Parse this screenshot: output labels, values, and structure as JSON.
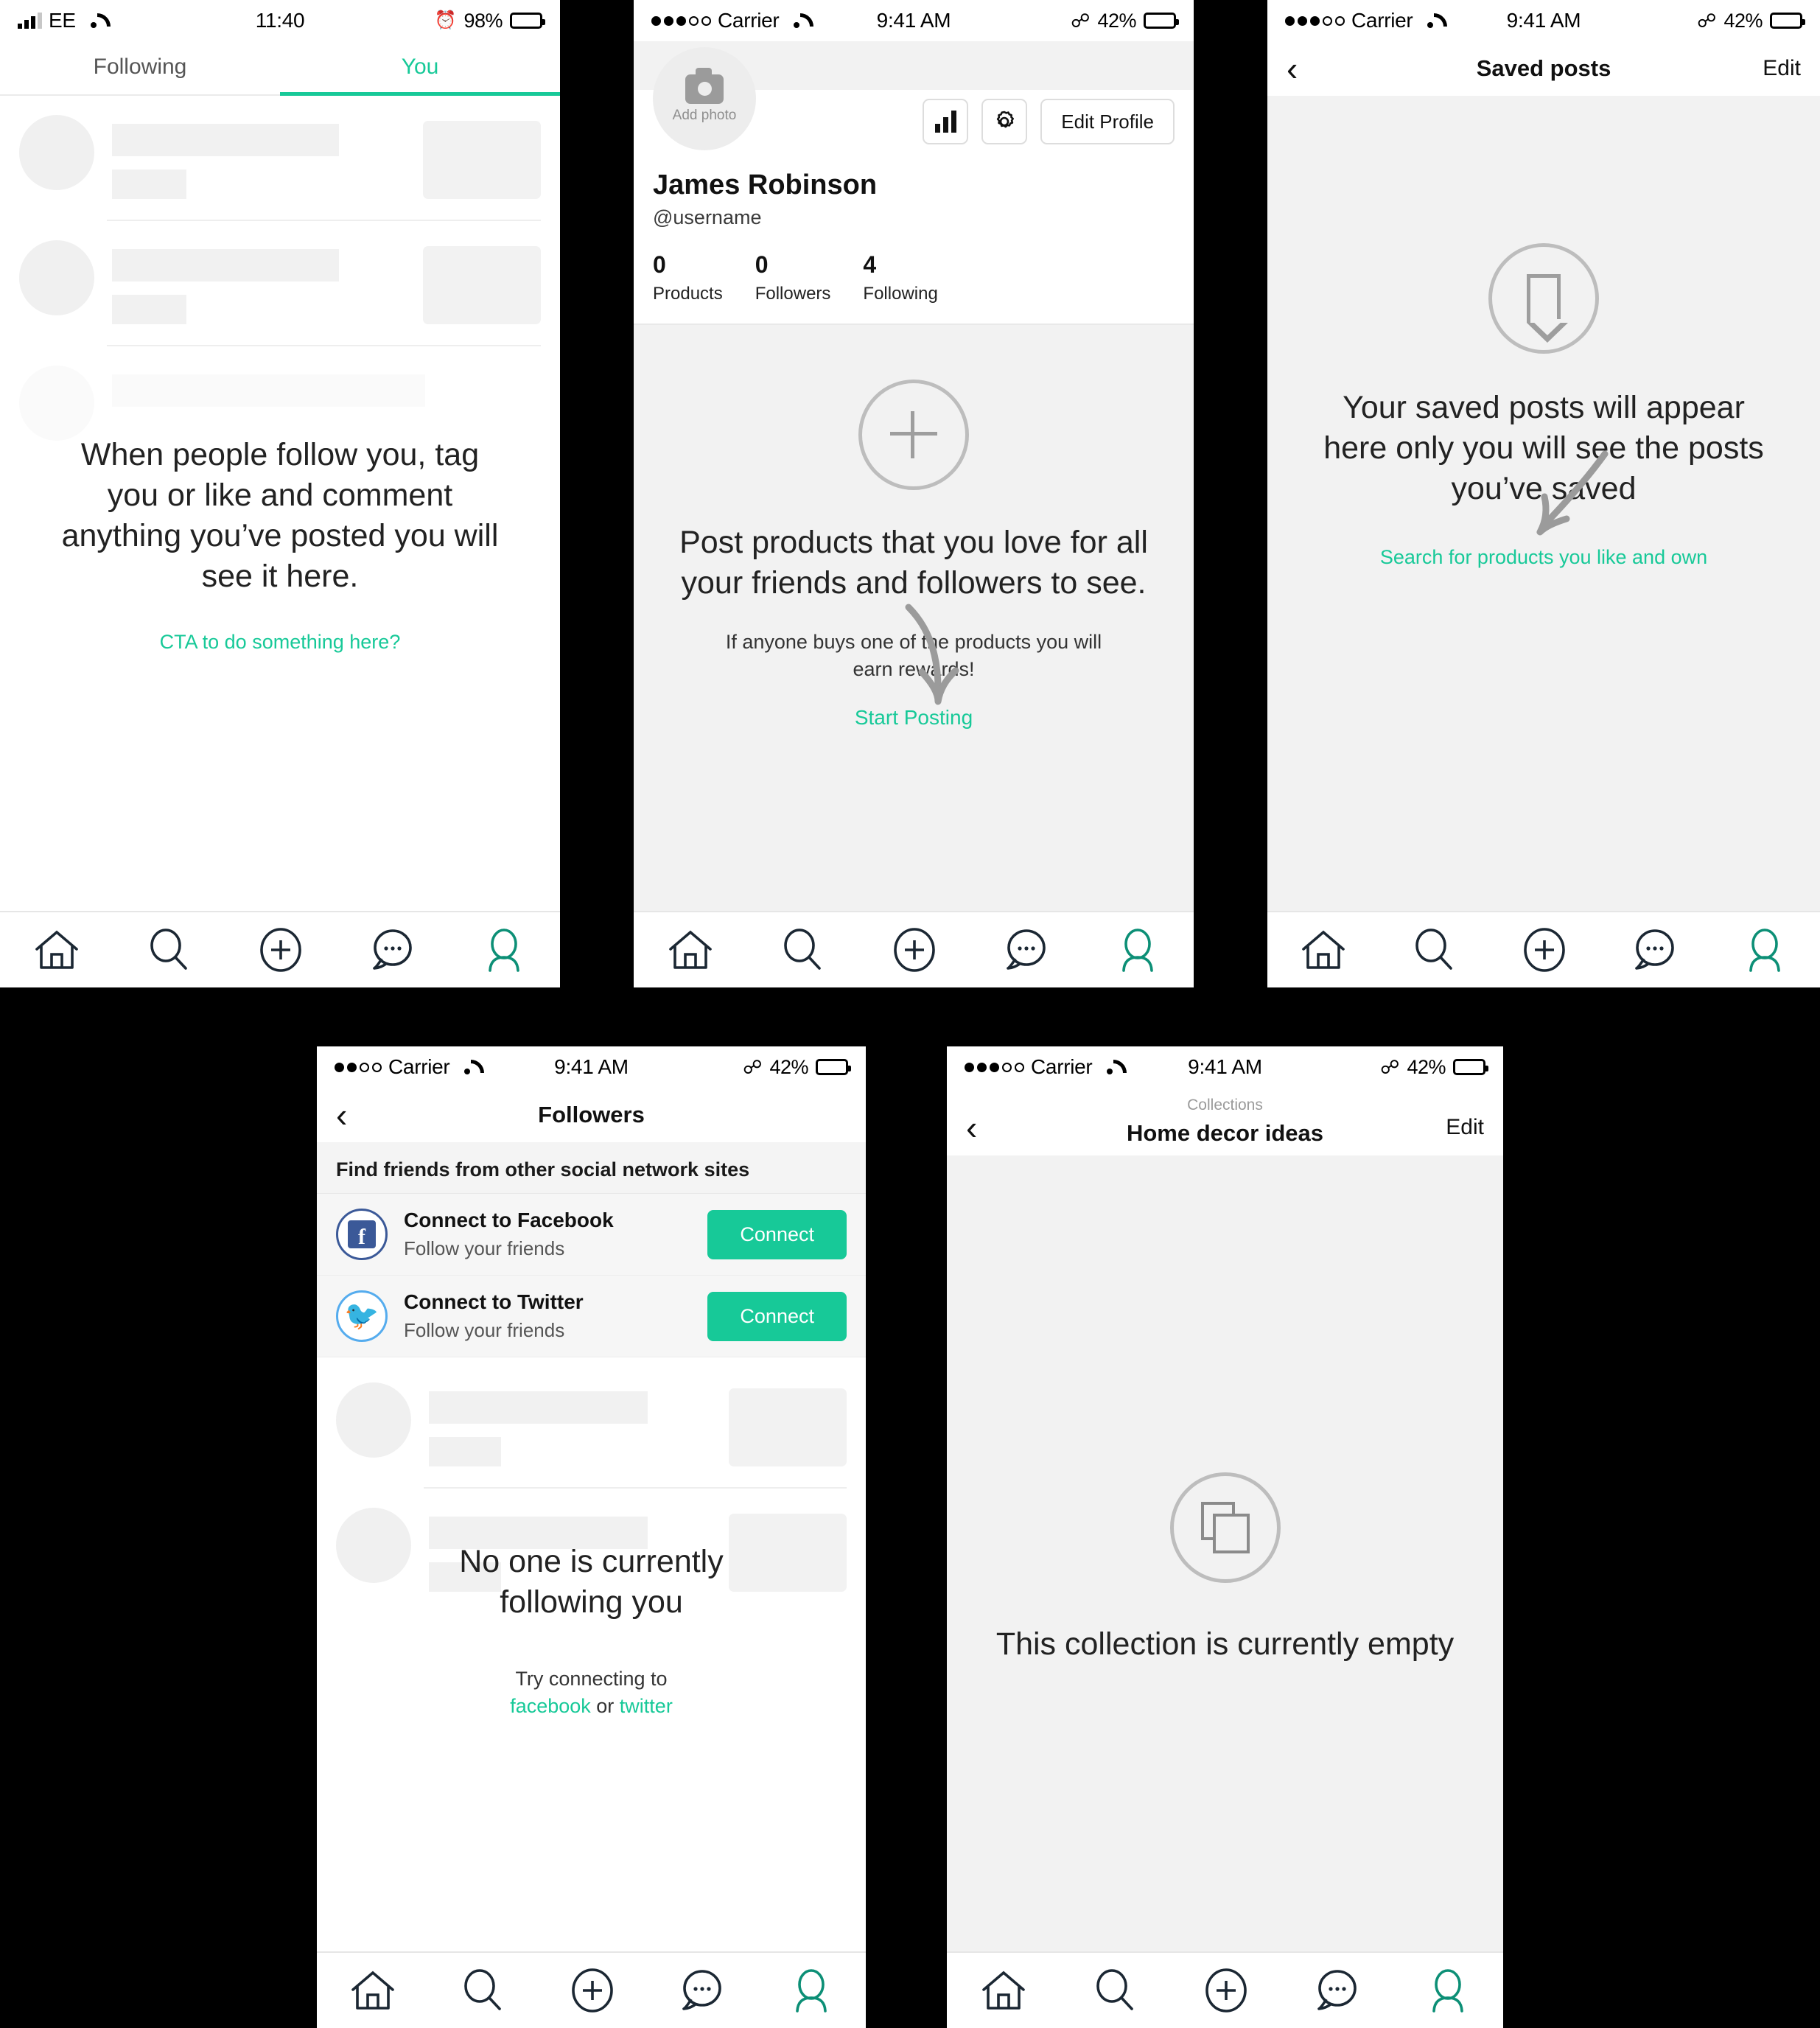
{
  "panels": {
    "activity": {
      "status": {
        "carrier": "EE",
        "time": "11:40",
        "battery_pct": "98%",
        "alarm": "alarm-icon"
      },
      "tabs": [
        {
          "label": "Following",
          "active": false
        },
        {
          "label": "You",
          "active": true
        }
      ],
      "empty": {
        "title": "When people follow you, tag you or like and comment anything you’ve posted you will see it here.",
        "link": "CTA to do something here?"
      }
    },
    "profile": {
      "status": {
        "carrier": "Carrier",
        "time": "9:41 AM",
        "battery_pct": "42%",
        "bluetooth": "bluetooth-icon"
      },
      "avatar_label": "Add photo",
      "actions": {
        "stats_icon": "bar-chart-icon",
        "settings_icon": "gear-icon",
        "edit_label": "Edit Profile"
      },
      "name": "James Robinson",
      "handle": "@username",
      "stats": [
        {
          "value": "0",
          "label": "Products"
        },
        {
          "value": "0",
          "label": "Followers"
        },
        {
          "value": "4",
          "label": "Following"
        }
      ],
      "empty": {
        "icon": "plus-circle-icon",
        "title": "Post products that you love for all your friends and followers to see.",
        "sub": "If anyone buys one of the products you will earn rewards!",
        "link": "Start Posting"
      }
    },
    "saved": {
      "status": {
        "carrier": "Carrier",
        "time": "9:41 AM",
        "battery_pct": "42%",
        "bluetooth": "bluetooth-icon"
      },
      "nav": {
        "back": "chevron-left-icon",
        "title": "Saved posts",
        "action": "Edit"
      },
      "empty": {
        "icon": "bookmark-circle-icon",
        "title": "Your saved posts will appear here only you will see the posts you’ve saved",
        "link": "Search for products you like and own"
      }
    },
    "followers": {
      "status": {
        "carrier": "Carrier",
        "time": "9:41 AM",
        "battery_pct": "42%",
        "bluetooth": "bluetooth-icon"
      },
      "nav": {
        "back": "chevron-left-icon",
        "title": "Followers"
      },
      "section_title": "Find friends from other social network sites",
      "social": [
        {
          "network": "facebook",
          "title": "Connect to Facebook",
          "subtitle": "Follow your friends",
          "button": "Connect"
        },
        {
          "network": "twitter",
          "title": "Connect to Twitter",
          "subtitle": "Follow your friends",
          "button": "Connect"
        }
      ],
      "empty": {
        "title": "No one is currently following you",
        "sub_prefix": "Try connecting to",
        "link_fb": "facebook",
        "sub_mid": " or ",
        "link_tw": "twitter"
      }
    },
    "collection": {
      "status": {
        "carrier": "Carrier",
        "time": "9:41 AM",
        "battery_pct": "42%",
        "bluetooth": "bluetooth-icon"
      },
      "nav": {
        "back": "chevron-left-icon",
        "eyebrow": "Collections",
        "title": "Home decor ideas",
        "action": "Edit"
      },
      "empty": {
        "icon": "copy-stack-icon",
        "title": "This collection is currently empty"
      }
    }
  },
  "tabbar": {
    "items": [
      {
        "icon": "home-icon",
        "active": false
      },
      {
        "icon": "search-icon",
        "active": false
      },
      {
        "icon": "plus-circle-icon",
        "active": false
      },
      {
        "icon": "chat-bubble-icon",
        "active": false
      },
      {
        "icon": "profile-icon",
        "active": true
      }
    ]
  },
  "colors": {
    "accent": "#17c998",
    "tab_active": "#0c8f76",
    "facebook": "#3b5998",
    "twitter": "#55acee",
    "text": "#222222",
    "muted": "#8e8e8e",
    "grey_bg": "#f2f2f2"
  }
}
